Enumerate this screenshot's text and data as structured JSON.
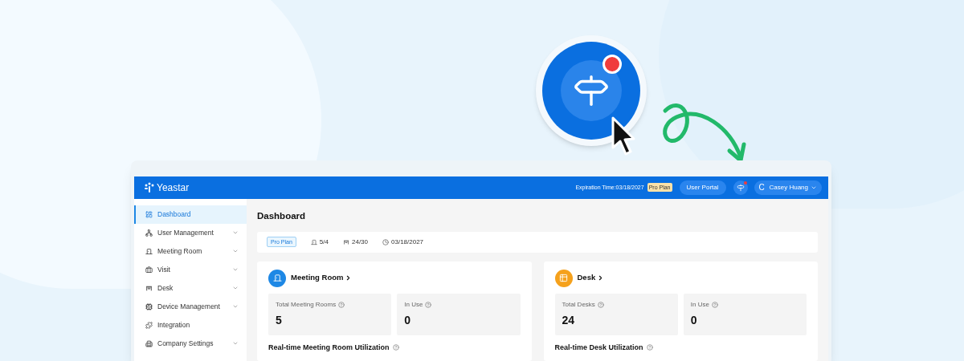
{
  "hero": {
    "notification": true
  },
  "header": {
    "logo": "Yeastar",
    "expiration": "Expiration Time:03/18/2027",
    "plan_badge": "Pro Plan",
    "user_portal": "User Portal",
    "notification": true,
    "user": {
      "initial": "C",
      "name": "Casey Huang"
    }
  },
  "sidebar": {
    "items": [
      {
        "label": "Dashboard",
        "expandable": false,
        "selected": true
      },
      {
        "label": "User Management",
        "expandable": true,
        "selected": false
      },
      {
        "label": "Meeting Room",
        "expandable": true,
        "selected": false
      },
      {
        "label": "Visit",
        "expandable": true,
        "selected": false
      },
      {
        "label": "Desk",
        "expandable": true,
        "selected": false
      },
      {
        "label": "Device Management",
        "expandable": true,
        "selected": false
      },
      {
        "label": "Integration",
        "expandable": false,
        "selected": false
      },
      {
        "label": "Company Settings",
        "expandable": true,
        "selected": false
      }
    ]
  },
  "page_title": "Dashboard",
  "plan_bar": {
    "plan": "Pro Plan",
    "items": [
      {
        "kind": "room",
        "text": "5/4"
      },
      {
        "kind": "desk",
        "text": "24/30"
      },
      {
        "kind": "clock",
        "text": "03/18/2027"
      }
    ]
  },
  "cards": [
    {
      "kind": "room",
      "color": "#1e88e5",
      "title": "Meeting Room",
      "stats": [
        {
          "label": "Total Meeting Rooms",
          "value": "5"
        },
        {
          "label": "In Use",
          "value": "0"
        }
      ],
      "section": "Real-time Meeting Room Utilization"
    },
    {
      "kind": "desk",
      "color": "#f5a11c",
      "title": "Desk",
      "stats": [
        {
          "label": "Total Desks",
          "value": "24"
        },
        {
          "label": "In Use",
          "value": "0"
        }
      ],
      "section": "Real-time Desk Utilization"
    }
  ]
}
